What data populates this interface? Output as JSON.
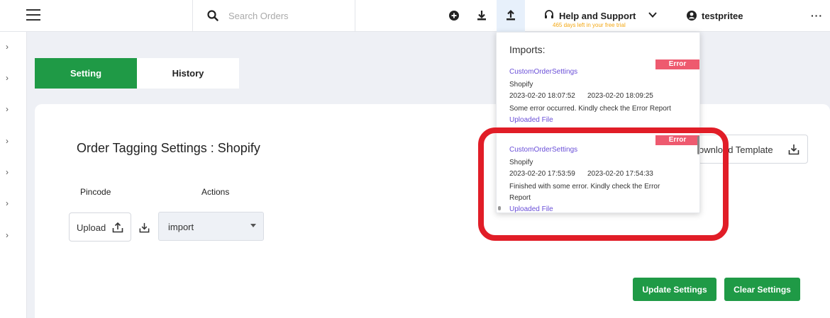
{
  "topbar": {
    "search_placeholder": "Search Orders",
    "help_label": "Help and Support",
    "trial_text": "465 days left in your free trial",
    "username": "testpritee"
  },
  "tabs": [
    {
      "label": "Setting",
      "active": true
    },
    {
      "label": "History",
      "active": false
    }
  ],
  "main": {
    "title": "Order Tagging Settings : Shopify",
    "col_pincode": "Pincode",
    "col_actions": "Actions",
    "upload_label": "Upload",
    "select_value": "import",
    "download_template": "ownload Template",
    "update_button": "Update Settings",
    "clear_button": "Clear Settings"
  },
  "imports": {
    "title": "Imports:",
    "items": [
      {
        "name": "CustomOrderSettings",
        "source": "Shopify",
        "start": "2023-02-20 18:07:52",
        "end": "2023-02-20 18:09:25",
        "message": "Some error occurred. Kindly check the Error Report",
        "message2": "",
        "link": "Uploaded File",
        "badge": "Error"
      },
      {
        "name": "CustomOrderSettings",
        "source": "Shopify",
        "start": "2023-02-20 17:53:59",
        "end": "2023-02-20 17:54:33",
        "message": "Finished with some error. Kindly check the Error",
        "message2": "Report",
        "link": "Uploaded File",
        "badge": "Error"
      }
    ]
  },
  "colors": {
    "accent_green": "#1f9a46",
    "error_badge": "#ee5a6f",
    "link_purple": "#6a4fd8",
    "trial_orange": "#f3a712",
    "highlight_red": "#e11d27"
  },
  "icons": [
    "menu-icon",
    "search-icon",
    "add-circle-icon",
    "download-icon",
    "upload-icon",
    "headset-icon",
    "chevron-down-icon",
    "user-icon",
    "more-icon",
    "chevron-right-icon"
  ]
}
